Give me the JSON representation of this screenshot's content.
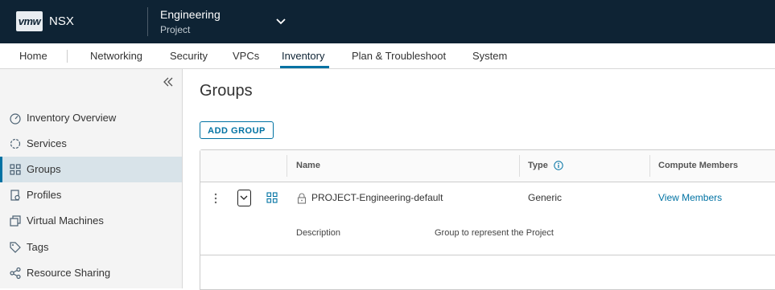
{
  "header": {
    "logo": "vmw",
    "app_name": "NSX",
    "project_name": "Engineering",
    "project_label": "Project"
  },
  "nav": {
    "items": [
      "Home",
      "Networking",
      "Security",
      "VPCs",
      "Inventory",
      "Plan & Troubleshoot",
      "System"
    ],
    "active": "Inventory"
  },
  "sidebar": {
    "items": [
      {
        "label": "Inventory Overview",
        "icon": "dashboard-icon"
      },
      {
        "label": "Services",
        "icon": "services-icon"
      },
      {
        "label": "Groups",
        "icon": "groups-icon"
      },
      {
        "label": "Profiles",
        "icon": "profiles-icon"
      },
      {
        "label": "Virtual Machines",
        "icon": "vm-icon"
      },
      {
        "label": "Tags",
        "icon": "tag-icon"
      },
      {
        "label": "Resource Sharing",
        "icon": "share-icon"
      }
    ],
    "active": "Groups"
  },
  "main": {
    "title": "Groups",
    "add_button": "ADD GROUP",
    "table": {
      "columns": [
        "Name",
        "Type",
        "Compute Members"
      ],
      "rows": [
        {
          "name": "PROJECT-Engineering-default",
          "type": "Generic",
          "members_link": "View Members",
          "description_label": "Description",
          "description": "Group to represent the Project"
        }
      ]
    }
  },
  "colors": {
    "header_bg": "#0e2334",
    "accent": "#0072a3",
    "sidebar_active": "#d8e3e9"
  }
}
